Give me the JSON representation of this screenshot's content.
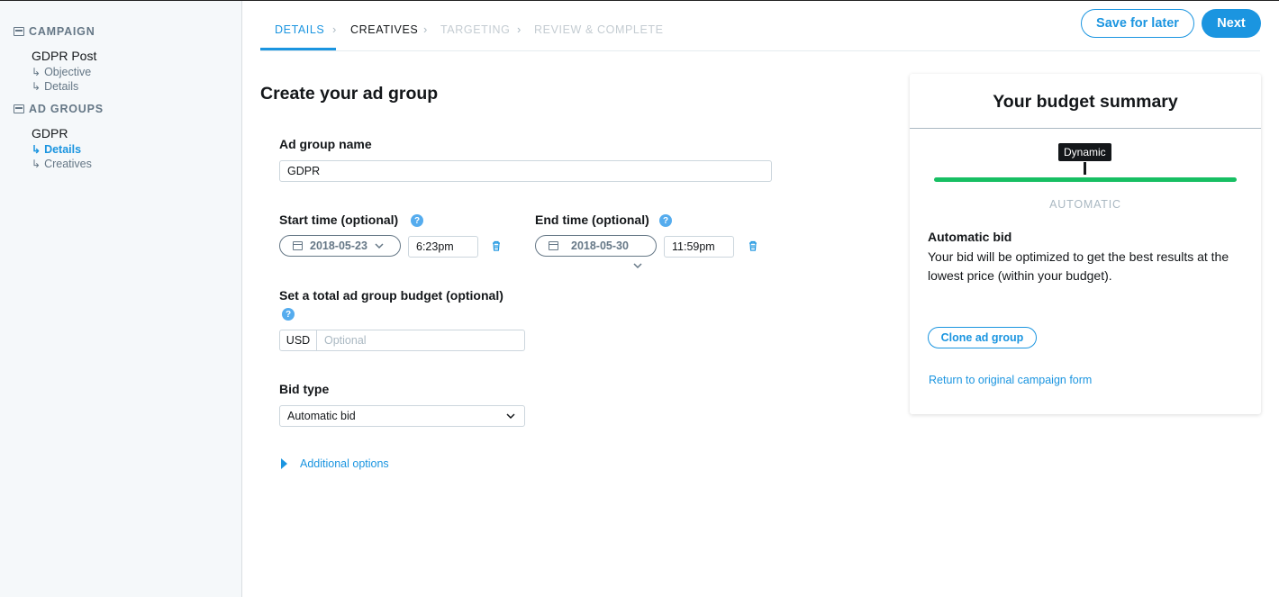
{
  "sidebar": {
    "campaign_section": "CAMPAIGN",
    "campaign_name": "GDPR Post",
    "campaign_items": [
      "Objective",
      "Details"
    ],
    "adgroups_section": "AD GROUPS",
    "adgroup_name": "GDPR",
    "adgroup_items": [
      "Details",
      "Creatives"
    ],
    "arrow": "↳"
  },
  "stepper": {
    "steps": [
      "DETAILS",
      "CREATIVES",
      "TARGETING",
      "REVIEW & COMPLETE"
    ],
    "separator": "›"
  },
  "actions": {
    "save_later": "Save for later",
    "next": "Next"
  },
  "form": {
    "title": "Create your ad group",
    "ad_group_name_label": "Ad group name",
    "ad_group_name_value": "GDPR",
    "start_label": "Start time (optional)",
    "start_date": "2018-05-23",
    "start_time": "6:23pm",
    "end_label": "End time (optional)",
    "end_date": "2018-05-30",
    "end_time": "11:59pm",
    "budget_label": "Set a total ad group budget (optional)",
    "currency": "USD",
    "budget_placeholder": "Optional",
    "bid_type_label": "Bid type",
    "bid_type_value": "Automatic bid",
    "additional_options": "Additional options",
    "help_glyph": "?"
  },
  "summary": {
    "title": "Your budget summary",
    "tooltip": "Dynamic",
    "caption": "AUTOMATIC",
    "bid_heading": "Automatic bid",
    "bid_text": "Your bid will be optimized to get the best results at the lowest price (within your budget).",
    "clone_button": "Clone ad group",
    "return_link": "Return to original campaign form"
  },
  "colors": {
    "accent": "#1b95e0",
    "green": "#17bf63"
  }
}
